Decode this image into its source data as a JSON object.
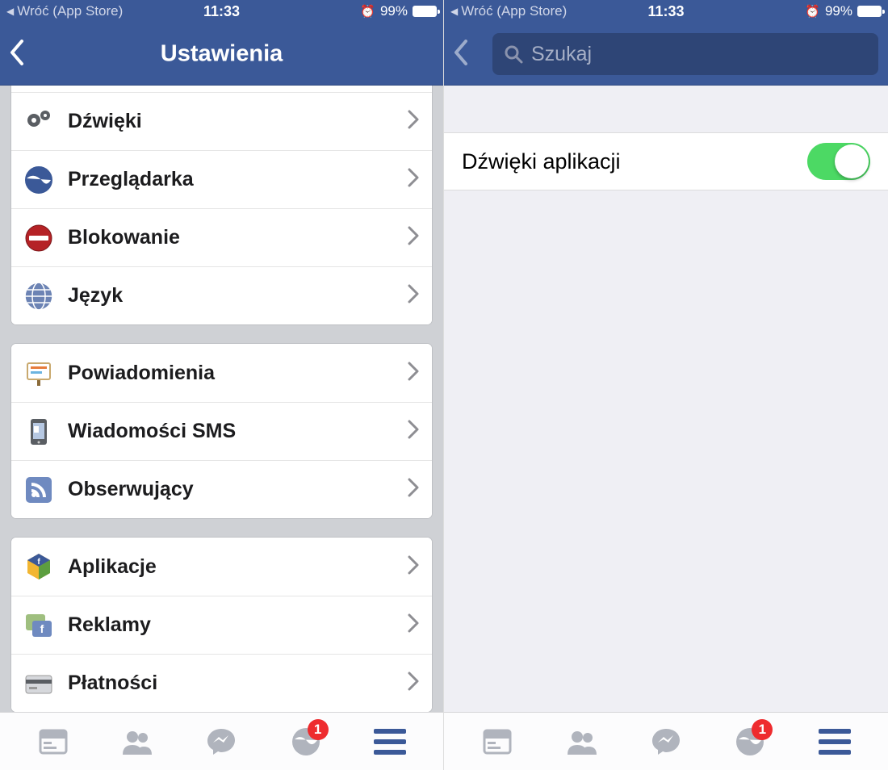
{
  "status": {
    "back_label": "Wróć (App Store)",
    "time": "11:33",
    "battery_pct": "99%"
  },
  "left": {
    "nav_title": "Ustawienia",
    "rows": {
      "sounds": "Dźwięki",
      "browser": "Przeglądarka",
      "blocking": "Blokowanie",
      "language": "Język",
      "notifications": "Powiadomienia",
      "sms": "Wiadomości SMS",
      "followers": "Obserwujący",
      "apps": "Aplikacje",
      "ads": "Reklamy",
      "payments": "Płatności"
    }
  },
  "right": {
    "search_placeholder": "Szukaj",
    "toggle_label": "Dźwięki aplikacji"
  },
  "tabs": {
    "notif_badge": "1"
  }
}
